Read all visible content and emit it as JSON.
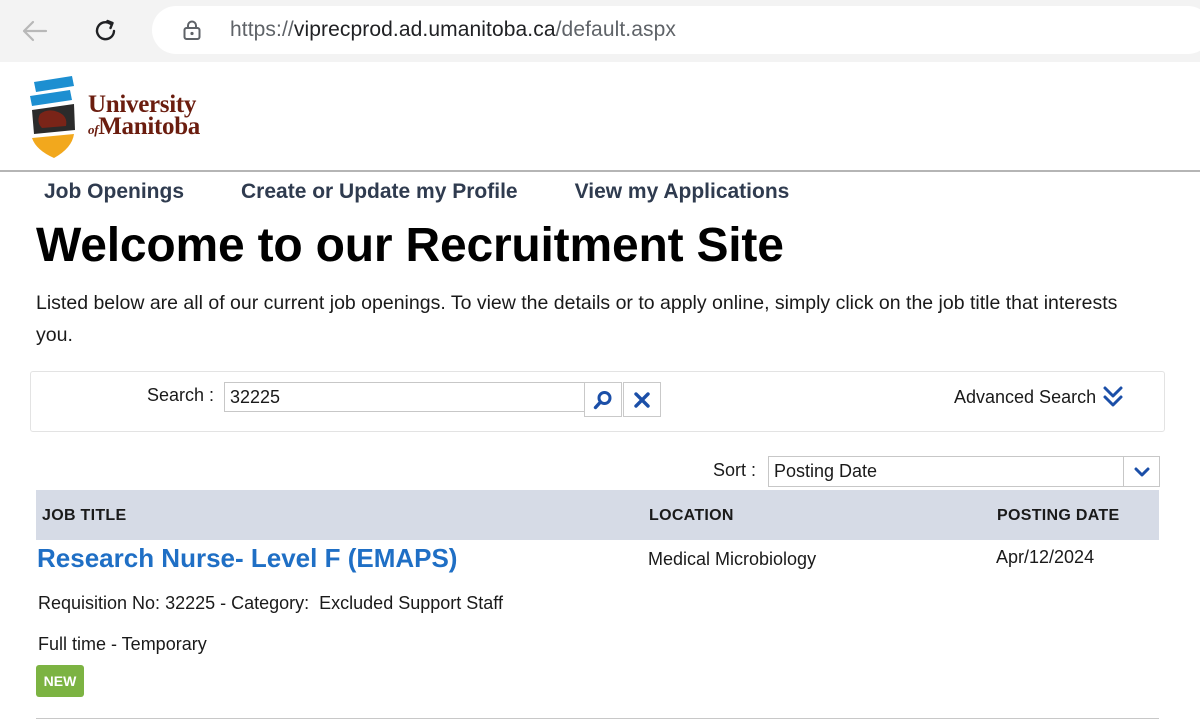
{
  "browser": {
    "url_prefix": "https://",
    "url_host": "viprecprod.ad.umanitoba.ca",
    "url_path": "/default.aspx"
  },
  "logo": {
    "line1": "University",
    "line2_of": "of",
    "line2_name": "Manitoba"
  },
  "nav": {
    "items": [
      {
        "label": "Job Openings"
      },
      {
        "label": "Create or Update my Profile"
      },
      {
        "label": "View my Applications"
      }
    ]
  },
  "page": {
    "title": "Welcome to our Recruitment Site",
    "intro": "Listed below are all of our current job openings. To view the details or to apply online, simply click on the job title that interests you."
  },
  "search": {
    "label": "Search :",
    "value": "32225",
    "advanced_label": "Advanced Search"
  },
  "sort": {
    "label": "Sort :",
    "selected": "Posting Date"
  },
  "table": {
    "headers": {
      "title": "JOB TITLE",
      "location": "LOCATION",
      "date": "POSTING DATE"
    },
    "rows": [
      {
        "title": "Research Nurse- Level F (EMAPS)",
        "location": "Medical Microbiology",
        "date": "Apr/12/2024",
        "requisition": "Requisition No: 32225 - Category:  Excluded Support Staff",
        "type": "Full time - Temporary",
        "badge": "NEW"
      }
    ]
  },
  "colors": {
    "link_blue": "#1f6fc5",
    "icon_blue": "#1b4fa8",
    "header_bg": "#d6dbe6",
    "badge_green": "#7cb342",
    "logo_brown": "#6b1d0f"
  }
}
